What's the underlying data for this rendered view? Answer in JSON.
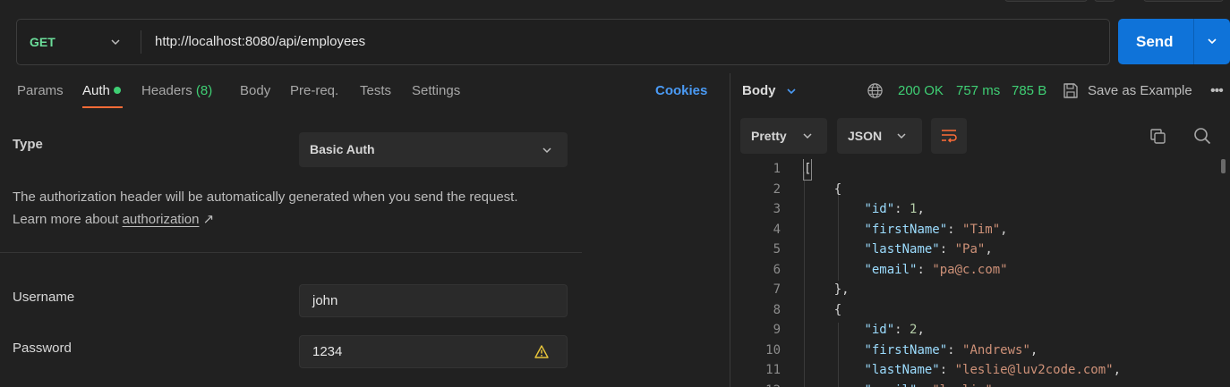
{
  "request": {
    "method": "GET",
    "url": "http://localhost:8080/api/employees",
    "send_label": "Send"
  },
  "tabs": {
    "params": "Params",
    "auth": "Auth",
    "headers": "Headers",
    "headers_count": "(8)",
    "body": "Body",
    "prereq": "Pre-req.",
    "tests": "Tests",
    "settings": "Settings",
    "cookies": "Cookies"
  },
  "auth": {
    "type_label": "Type",
    "type_value": "Basic Auth",
    "description": "The authorization header will be automatically generated when you send the request. Learn more about ",
    "link_text": "authorization",
    "link_arrow": "↗",
    "username_label": "Username",
    "username_value": "john",
    "password_label": "Password",
    "password_value": "1234"
  },
  "response": {
    "body_label": "Body",
    "status": "200 OK",
    "time": "757 ms",
    "size": "785 B",
    "save_label": "Save as Example",
    "more": "•••",
    "format": "Pretty",
    "language": "JSON"
  },
  "code_lines": [
    "[",
    "    {",
    "        \"id\": 1,",
    "        \"firstName\": \"Tim\",",
    "        \"lastName\": \"Pa\",",
    "        \"email\": \"pa@c.com\"",
    "    },",
    "    {",
    "        \"id\": 2,",
    "        \"firstName\": \"Andrews\",",
    "        \"lastName\": \"leslie@luv2code.com\",",
    "        \"email\": \"leslie\","
  ],
  "icons": {
    "method_dropdown": "chevron-down-icon",
    "send_dropdown": "chevron-down-icon",
    "globe": "globe-icon",
    "save": "save-icon",
    "wrap": "wrap-lines-icon",
    "copy": "copy-icon",
    "search": "search-icon",
    "warning": "warning-icon"
  },
  "colors": {
    "accent_orange": "#ff6c37",
    "send_blue": "#0f73d9",
    "success_green": "#3fcf74",
    "link_blue": "#4a9af4",
    "warning_yellow": "#e8c53a"
  }
}
